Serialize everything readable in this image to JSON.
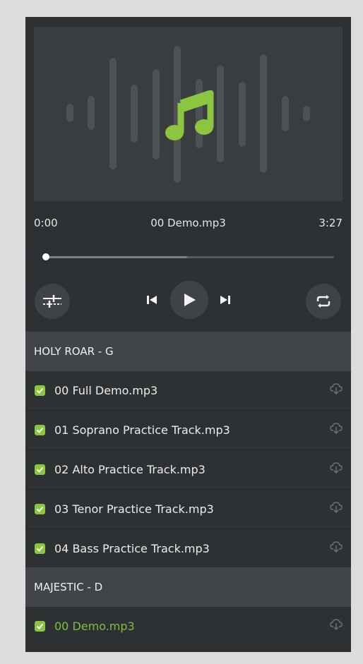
{
  "player": {
    "current_time": "0:00",
    "track_title": "00 Demo.mp3",
    "duration": "3:27",
    "progress_fraction": 0.0,
    "buffered_fraction": 0.49
  },
  "controls": {
    "mixer_icon": "sliders-icon",
    "prev_icon": "skip-back-icon",
    "play_icon": "play-icon",
    "next_icon": "skip-forward-icon",
    "repeat_icon": "repeat-icon"
  },
  "playlist": [
    {
      "section": "HOLY ROAR - G",
      "tracks": [
        {
          "label": "00 Full Demo.mp3",
          "checked": true
        },
        {
          "label": "01 Soprano Practice Track.mp3",
          "checked": true
        },
        {
          "label": "02 Alto Practice Track.mp3",
          "checked": true
        },
        {
          "label": "03 Tenor Practice Track.mp3",
          "checked": true
        },
        {
          "label": "04 Bass Practice Track.mp3",
          "checked": true
        }
      ]
    },
    {
      "section": "MAJESTIC - D",
      "tracks": [
        {
          "label": "00 Demo.mp3",
          "checked": true,
          "active": true
        }
      ]
    }
  ],
  "colors": {
    "accent": "#8cc63f",
    "background": "#2e3134",
    "section_header": "#41454a"
  }
}
